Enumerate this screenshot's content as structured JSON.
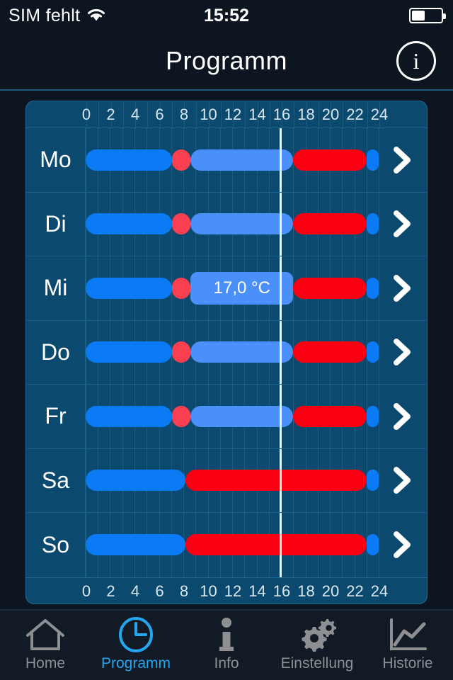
{
  "statusbar": {
    "carrier": "SIM fehlt",
    "wifi_icon": "wifi-icon",
    "time": "15:52",
    "battery_icon": "battery-icon",
    "battery_level_pct": 40
  },
  "navbar": {
    "title": "Programm",
    "info_label": "i",
    "info_icon": "info-circle-icon"
  },
  "schedule": {
    "axis_ticks": [
      "0",
      "2",
      "4",
      "6",
      "8",
      "10",
      "12",
      "14",
      "16",
      "18",
      "20",
      "22",
      "24"
    ],
    "axis_min_hour": 0,
    "axis_max_hour": 24,
    "current_time_hour": 15.87,
    "chevron_icon": "chevron-right-icon",
    "tooltip": {
      "row": "Mi",
      "text": "17,0 °C"
    },
    "colors": {
      "comfort_blue": "#0a7bf5",
      "mid_blue": "#4a90f8",
      "hot_red": "#f90012",
      "warm_red": "#fa4050",
      "panel_bg": "#0b4a6e",
      "grid": "#1b628c",
      "cursor": "#f2f4f0",
      "accent": "#22a7f0"
    },
    "rows": [
      {
        "day": "Mo",
        "segments": [
          {
            "from": 0.0,
            "to": 7.1,
            "color": "#0a7bf5",
            "label": ""
          },
          {
            "from": 7.1,
            "to": 8.6,
            "color": "#fa4050",
            "label": ""
          },
          {
            "from": 8.6,
            "to": 17.0,
            "color": "#4a90f8",
            "label": ""
          },
          {
            "from": 17.0,
            "to": 23.0,
            "color": "#f90012",
            "label": ""
          },
          {
            "from": 23.0,
            "to": 24.0,
            "color": "#0a7bf5",
            "label": ""
          }
        ]
      },
      {
        "day": "Di",
        "segments": [
          {
            "from": 0.0,
            "to": 7.1,
            "color": "#0a7bf5",
            "label": ""
          },
          {
            "from": 7.1,
            "to": 8.6,
            "color": "#fa4050",
            "label": ""
          },
          {
            "from": 8.6,
            "to": 17.0,
            "color": "#4a90f8",
            "label": ""
          },
          {
            "from": 17.0,
            "to": 23.0,
            "color": "#f90012",
            "label": ""
          },
          {
            "from": 23.0,
            "to": 24.0,
            "color": "#0a7bf5",
            "label": ""
          }
        ]
      },
      {
        "day": "Mi",
        "segments": [
          {
            "from": 0.0,
            "to": 7.1,
            "color": "#0a7bf5",
            "label": ""
          },
          {
            "from": 7.1,
            "to": 8.6,
            "color": "#fa4050",
            "label": ""
          },
          {
            "from": 8.6,
            "to": 17.0,
            "color": "#4a90f8",
            "label": "17,0 °C"
          },
          {
            "from": 17.0,
            "to": 23.0,
            "color": "#f90012",
            "label": ""
          },
          {
            "from": 23.0,
            "to": 24.0,
            "color": "#0a7bf5",
            "label": ""
          }
        ]
      },
      {
        "day": "Do",
        "segments": [
          {
            "from": 0.0,
            "to": 7.1,
            "color": "#0a7bf5",
            "label": ""
          },
          {
            "from": 7.1,
            "to": 8.6,
            "color": "#fa4050",
            "label": ""
          },
          {
            "from": 8.6,
            "to": 17.0,
            "color": "#4a90f8",
            "label": ""
          },
          {
            "from": 17.0,
            "to": 23.0,
            "color": "#f90012",
            "label": ""
          },
          {
            "from": 23.0,
            "to": 24.0,
            "color": "#0a7bf5",
            "label": ""
          }
        ]
      },
      {
        "day": "Fr",
        "segments": [
          {
            "from": 0.0,
            "to": 7.1,
            "color": "#0a7bf5",
            "label": ""
          },
          {
            "from": 7.1,
            "to": 8.6,
            "color": "#fa4050",
            "label": ""
          },
          {
            "from": 8.6,
            "to": 17.0,
            "color": "#4a90f8",
            "label": ""
          },
          {
            "from": 17.0,
            "to": 23.0,
            "color": "#f90012",
            "label": ""
          },
          {
            "from": 23.0,
            "to": 24.0,
            "color": "#0a7bf5",
            "label": ""
          }
        ]
      },
      {
        "day": "Sa",
        "segments": [
          {
            "from": 0.0,
            "to": 8.2,
            "color": "#0a7bf5",
            "label": ""
          },
          {
            "from": 8.2,
            "to": 23.0,
            "color": "#f90012",
            "label": ""
          },
          {
            "from": 23.0,
            "to": 24.0,
            "color": "#0a7bf5",
            "label": ""
          }
        ]
      },
      {
        "day": "So",
        "segments": [
          {
            "from": 0.0,
            "to": 8.2,
            "color": "#0a7bf5",
            "label": ""
          },
          {
            "from": 8.2,
            "to": 23.0,
            "color": "#f90012",
            "label": ""
          },
          {
            "from": 23.0,
            "to": 24.0,
            "color": "#0a7bf5",
            "label": ""
          }
        ]
      }
    ]
  },
  "tabbar": {
    "active_index": 1,
    "tabs": [
      {
        "label": "Home",
        "icon": "home-icon"
      },
      {
        "label": "Programm",
        "icon": "clock-icon"
      },
      {
        "label": "Info",
        "icon": "info-icon"
      },
      {
        "label": "Einstellung",
        "icon": "gears-icon"
      },
      {
        "label": "Historie",
        "icon": "chart-line-icon"
      }
    ]
  }
}
